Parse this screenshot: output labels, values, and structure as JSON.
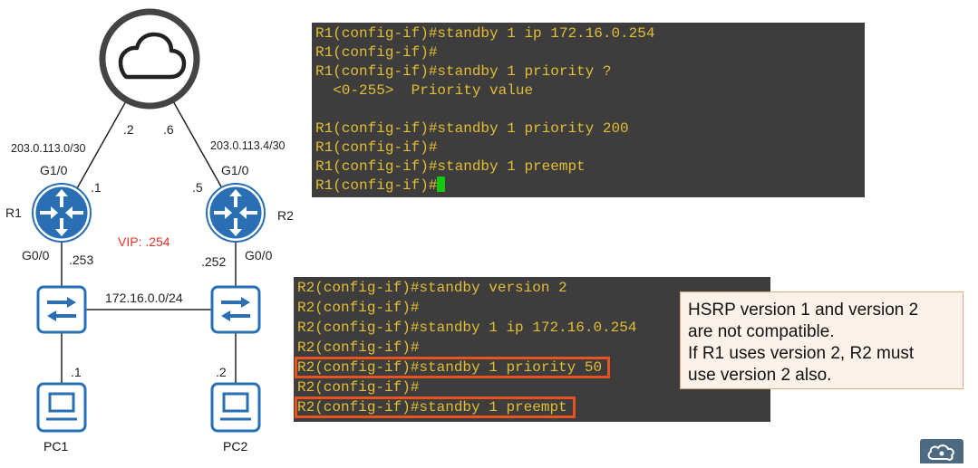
{
  "topology": {
    "r1": {
      "name": "R1",
      "top_iface": "G1/0",
      "bottom_iface": "G0/0",
      "top_ip": ".1",
      "bottom_ip": ".253"
    },
    "r2": {
      "name": "R2",
      "top_iface": "G1/0",
      "bottom_iface": "G0/0",
      "top_ip": ".5",
      "bottom_ip": ".252"
    },
    "cloud_r1_ip": ".2",
    "cloud_r2_ip": ".6",
    "net_r1_cloud": "203.0.113.0/30",
    "net_r2_cloud": "203.0.113.4/30",
    "lan_net": "172.16.0.0/24",
    "vip": "VIP: .254",
    "pc1": {
      "name": "PC1",
      "ip": ".1"
    },
    "pc2": {
      "name": "PC2",
      "ip": ".2"
    }
  },
  "terminal_r1": {
    "lines": [
      "R1(config-if)#standby 1 ip 172.16.0.254",
      "R1(config-if)#",
      "R1(config-if)#standby 1 priority ?",
      "  <0-255>  Priority value",
      "",
      "R1(config-if)#standby 1 priority 200",
      "R1(config-if)#",
      "R1(config-if)#standby 1 preempt",
      "R1(config-if)#"
    ]
  },
  "terminal_r2": {
    "lines": [
      "R2(config-if)#standby version 2",
      "R2(config-if)#",
      "R2(config-if)#standby 1 ip 172.16.0.254",
      "R2(config-if)#",
      "R2(config-if)#standby 1 priority 50",
      "R2(config-if)#",
      "R2(config-if)#standby 1 preempt"
    ]
  },
  "note": {
    "line1": "HSRP version 1 and version 2",
    "line2": "are not compatible.",
    "line3": "If R1 uses version 2, R2 must",
    "line4": "use version 2 also."
  },
  "colors": {
    "device_blue": "#2a6fb3",
    "vip_red": "#e0352b",
    "terminal_bg": "#3d3d3d",
    "terminal_text": "#e4bd34",
    "highlight_orange": "#e8531f",
    "note_bg": "#fdf2e9",
    "note_border": "#e9a97c",
    "cursor_green": "#16c80c"
  }
}
